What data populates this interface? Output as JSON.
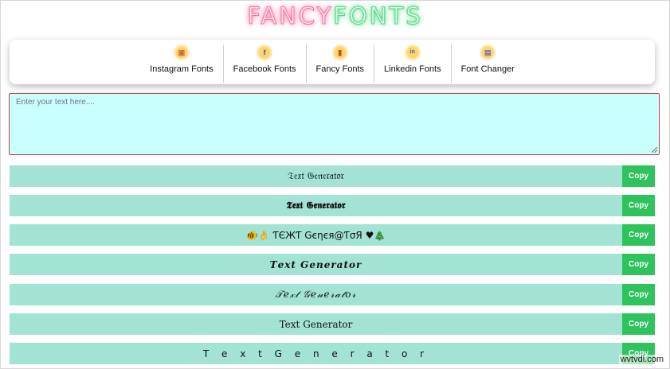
{
  "logo": {
    "word1": "FANCY",
    "word2": "FONTS"
  },
  "nav": {
    "items": [
      {
        "label": "Instagram Fonts",
        "icon": "instagram-icon",
        "glyph": "▣",
        "color": "#c96b3a"
      },
      {
        "label": "Facebook Fonts",
        "icon": "facebook-icon",
        "glyph": "f",
        "color": "#3b5ba8"
      },
      {
        "label": "Fancy Fonts",
        "icon": "fancy-fonts-icon",
        "glyph": "▮",
        "color": "#b45a1e"
      },
      {
        "label": "Linkedin Fonts",
        "icon": "linkedin-icon",
        "glyph": "in",
        "color": "#2b6cb0"
      },
      {
        "label": "Font Changer",
        "icon": "font-changer-icon",
        "glyph": "▤",
        "color": "#7b6fb8"
      }
    ]
  },
  "input": {
    "placeholder": "Enter your text here....",
    "value": ""
  },
  "results": [
    {
      "text": "𝔗𝔢𝔵𝔱 𝔊𝔢𝔫𝔢𝔯𝔞𝔱𝔬𝔯",
      "copy_label": "Copy"
    },
    {
      "text": "𝕿𝖊𝖝𝖙 𝕲𝖊𝖓𝖊𝖗𝖆𝖙𝖔𝖗",
      "copy_label": "Copy"
    },
    {
      "text": "🐠👌 ƬЄЖƬ Gєηєя@ƬσЯ ♥🎄",
      "copy_label": "Copy"
    },
    {
      "text": "𝑻𝒆𝒙𝒕 𝑮𝒆𝒏𝒆𝒓𝒂𝒕𝒐𝒓",
      "copy_label": "Copy"
    },
    {
      "text": "𝒯𝑒𝓍𝓉 𝒢𝑒𝓃𝑒𝓇𝒶𝓉𝑜𝓇",
      "copy_label": "Copy"
    },
    {
      "text": "Text Generator",
      "copy_label": "Copy"
    },
    {
      "text": "T e x t  G e n e r a t o r",
      "copy_label": "Copy"
    }
  ],
  "watermark": "wvtvdi.com"
}
